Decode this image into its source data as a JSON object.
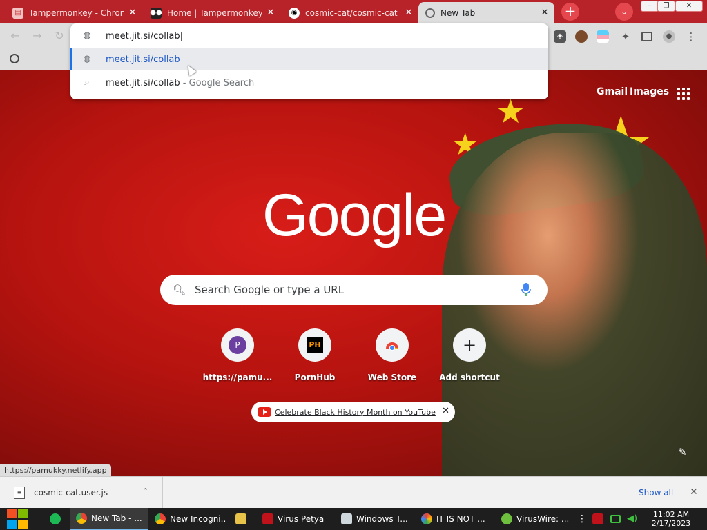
{
  "tabs": [
    {
      "title": "Tampermonkey - Chrom",
      "close": "✕"
    },
    {
      "title": "Home | Tampermonkey",
      "close": "✕"
    },
    {
      "title": "cosmic-cat/cosmic-cat",
      "close": "✕"
    },
    {
      "title": "New Tab",
      "close": "✕"
    }
  ],
  "window_controls": {
    "new_tab": "+",
    "tab_search": "⌄",
    "minimize": "–",
    "maximize": "❐",
    "close": "✕"
  },
  "colors": {
    "frame": "#b8232a",
    "accent": "#1a73e8",
    "link": "#1a55c7",
    "ntp_bg": "#c4140f"
  },
  "bookmarks": [
    {
      "label": ""
    },
    {
      "label": ""
    }
  ],
  "omnibox": {
    "input_value": "meet.jit.si/collab|",
    "suggestions": [
      {
        "icon": "globe-icon",
        "text": "meet.jit.si/collab",
        "suffix": ""
      },
      {
        "icon": "search-icon",
        "text": "meet.jit.si/collab",
        "suffix": " - Google Search"
      }
    ]
  },
  "ntp": {
    "gmail": "Gmail",
    "images": "Images",
    "logo": "Google",
    "search_placeholder": "Search Google or type a URL",
    "shortcuts": [
      {
        "label": "https://pamu...",
        "icon_text": "P"
      },
      {
        "label": "PornHub",
        "icon_text": "PH"
      },
      {
        "label": "Web Store",
        "icon_text": ""
      },
      {
        "label": "Add shortcut",
        "icon_text": "+"
      }
    ],
    "promo": {
      "text": "Celebrate Black History Month on YouTube",
      "close": "✕"
    },
    "status_url": "https://pamukky.netlify.app"
  },
  "download_bar": {
    "file": "cosmic-cat.user.js",
    "show_all": "Show all",
    "close": "✕"
  },
  "taskbar": {
    "items": [
      {
        "label": "New Tab - ..."
      },
      {
        "label": "New Incogni..."
      },
      {
        "label": ""
      },
      {
        "label": "Virus Petya"
      },
      {
        "label": "Windows T..."
      },
      {
        "label": "IT IS NOT ..."
      },
      {
        "label": "VirusWire: ..."
      }
    ],
    "time": "11:02 AM",
    "date": "2/17/2023"
  }
}
